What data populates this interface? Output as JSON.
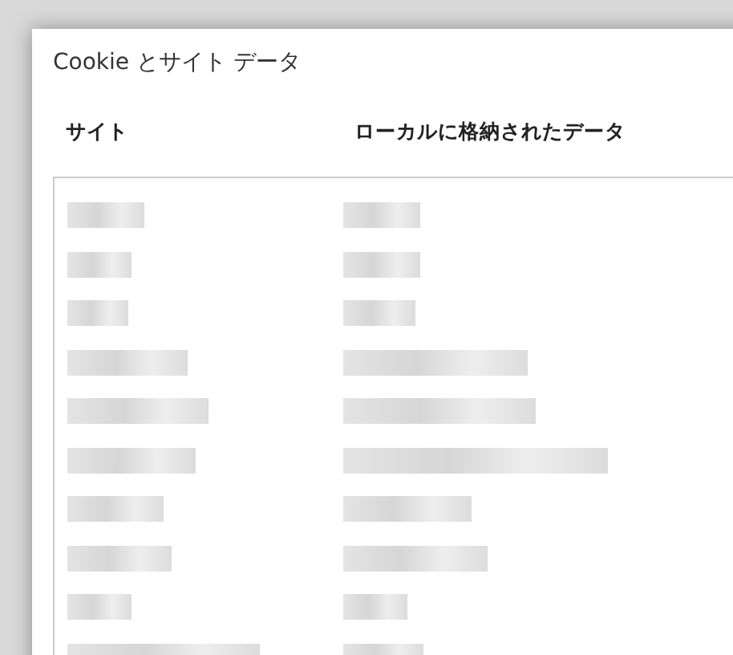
{
  "dialog": {
    "title": "Cookie とサイト データ"
  },
  "table": {
    "columns": [
      "サイト",
      "ローカルに格納されたデータ"
    ],
    "rows": [
      {
        "kind": "redacted"
      },
      {
        "kind": "redacted"
      },
      {
        "kind": "redacted"
      },
      {
        "kind": "redacted"
      },
      {
        "kind": "redacted"
      },
      {
        "kind": "redacted"
      },
      {
        "kind": "redacted"
      },
      {
        "kind": "redacted"
      },
      {
        "kind": "redacted"
      },
      {
        "kind": "redacted"
      }
    ]
  }
}
